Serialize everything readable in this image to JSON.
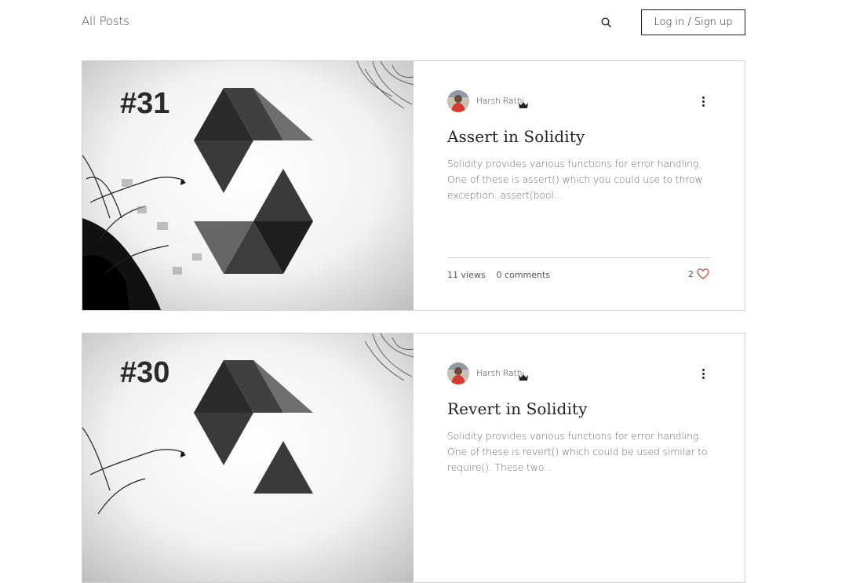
{
  "header": {
    "all_posts": "All Posts",
    "login_label": "Log in / Sign up",
    "search_icon": "search-icon"
  },
  "posts": [
    {
      "cover_number": "#31",
      "author": "Harsh Rathi",
      "title": "Assert in Solidity",
      "excerpt": "Solidity provides various functions for error handling. One of these is assert() which you could use to throw exception. assert(bool...",
      "views": "11 views",
      "comments": "0 comments",
      "likes": "2"
    },
    {
      "cover_number": "#30",
      "author": "Harsh Rathi",
      "title": "Revert in Solidity",
      "excerpt": "Solidity provides various functions for error handling. One of these is revert() which could be used similar to require(). These two...",
      "views": "",
      "comments": "",
      "likes": ""
    }
  ],
  "colors": {
    "like_heart": "#e0413c",
    "text_dark": "#222222",
    "border": "#cfcfcf"
  }
}
